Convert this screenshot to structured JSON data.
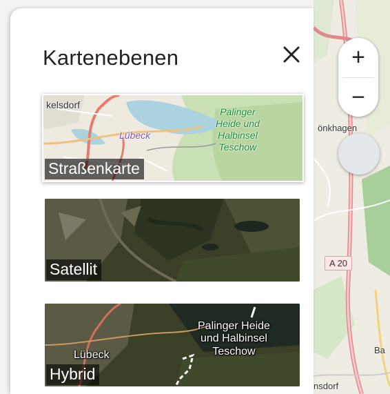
{
  "panel": {
    "title": "Kartenebenen",
    "close_icon": "close-icon",
    "layers": [
      {
        "label": "Straßenkarte",
        "selected": true,
        "thumb_labels": {
          "place_1": "kelsdorf",
          "place_2": "Lübeck",
          "park": "Palinger\nHeide und\nHalbinsel\nTeschow"
        }
      },
      {
        "label": "Satellit",
        "selected": false
      },
      {
        "label": "Hybrid",
        "selected": false,
        "thumb_labels": {
          "place": "Lübeck",
          "park": "Palinger Heide\nund Halbinsel\nTeschow"
        }
      }
    ]
  },
  "map": {
    "zoom_in_label": "+",
    "zoom_out_label": "−",
    "locate_icon": "locate-icon",
    "labels": {
      "top": "önkhagen",
      "road": "A 20",
      "right": "Ba",
      "bottom": "nsdorf"
    }
  },
  "colors": {
    "selected_border": "#ffffff",
    "label_bg": "rgba(0,0,0,0.6)",
    "park_text": "#1f8a3a"
  }
}
